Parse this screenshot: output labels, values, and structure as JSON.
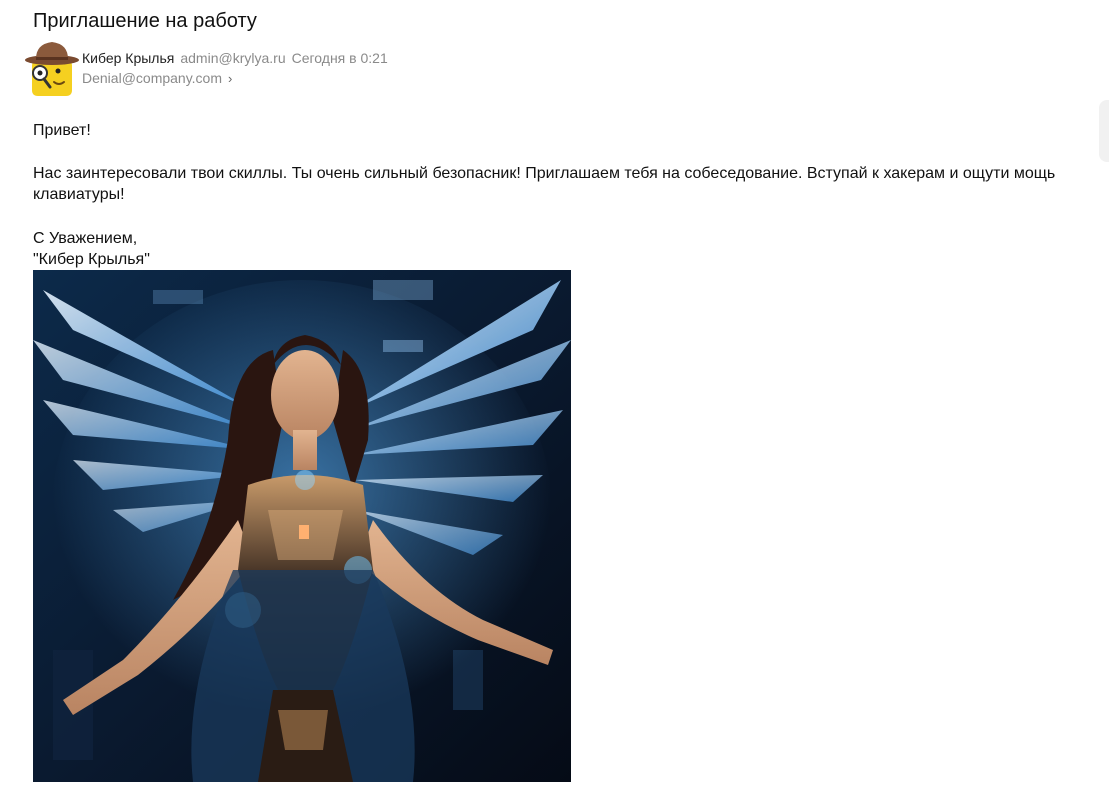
{
  "email": {
    "subject": "Приглашение на работу",
    "sender": {
      "name": "Кибер Крылья",
      "email": "admin@krylya.ru",
      "date": "Сегодня в 0:21"
    },
    "recipient": {
      "email": "Denial@company.com"
    },
    "body": {
      "greeting": "Привет!",
      "text": "Нас заинтересовали твои скиллы. Ты очень сильный безопасник! Приглашаем тебя на собеседование. Вступай к хакерам и ощути мощь клавиатуры!",
      "sign_line1": "С Уважением,",
      "sign_line2": "\"Кибер Крылья\""
    }
  },
  "icons": {
    "avatar": "spy-hat-avatar-icon",
    "recipient_expand": "chevron-right-icon"
  },
  "colors": {
    "muted_text": "#8a8a8a",
    "avatar_yellow": "#f5d020",
    "avatar_hat": "#8b5a3c"
  }
}
